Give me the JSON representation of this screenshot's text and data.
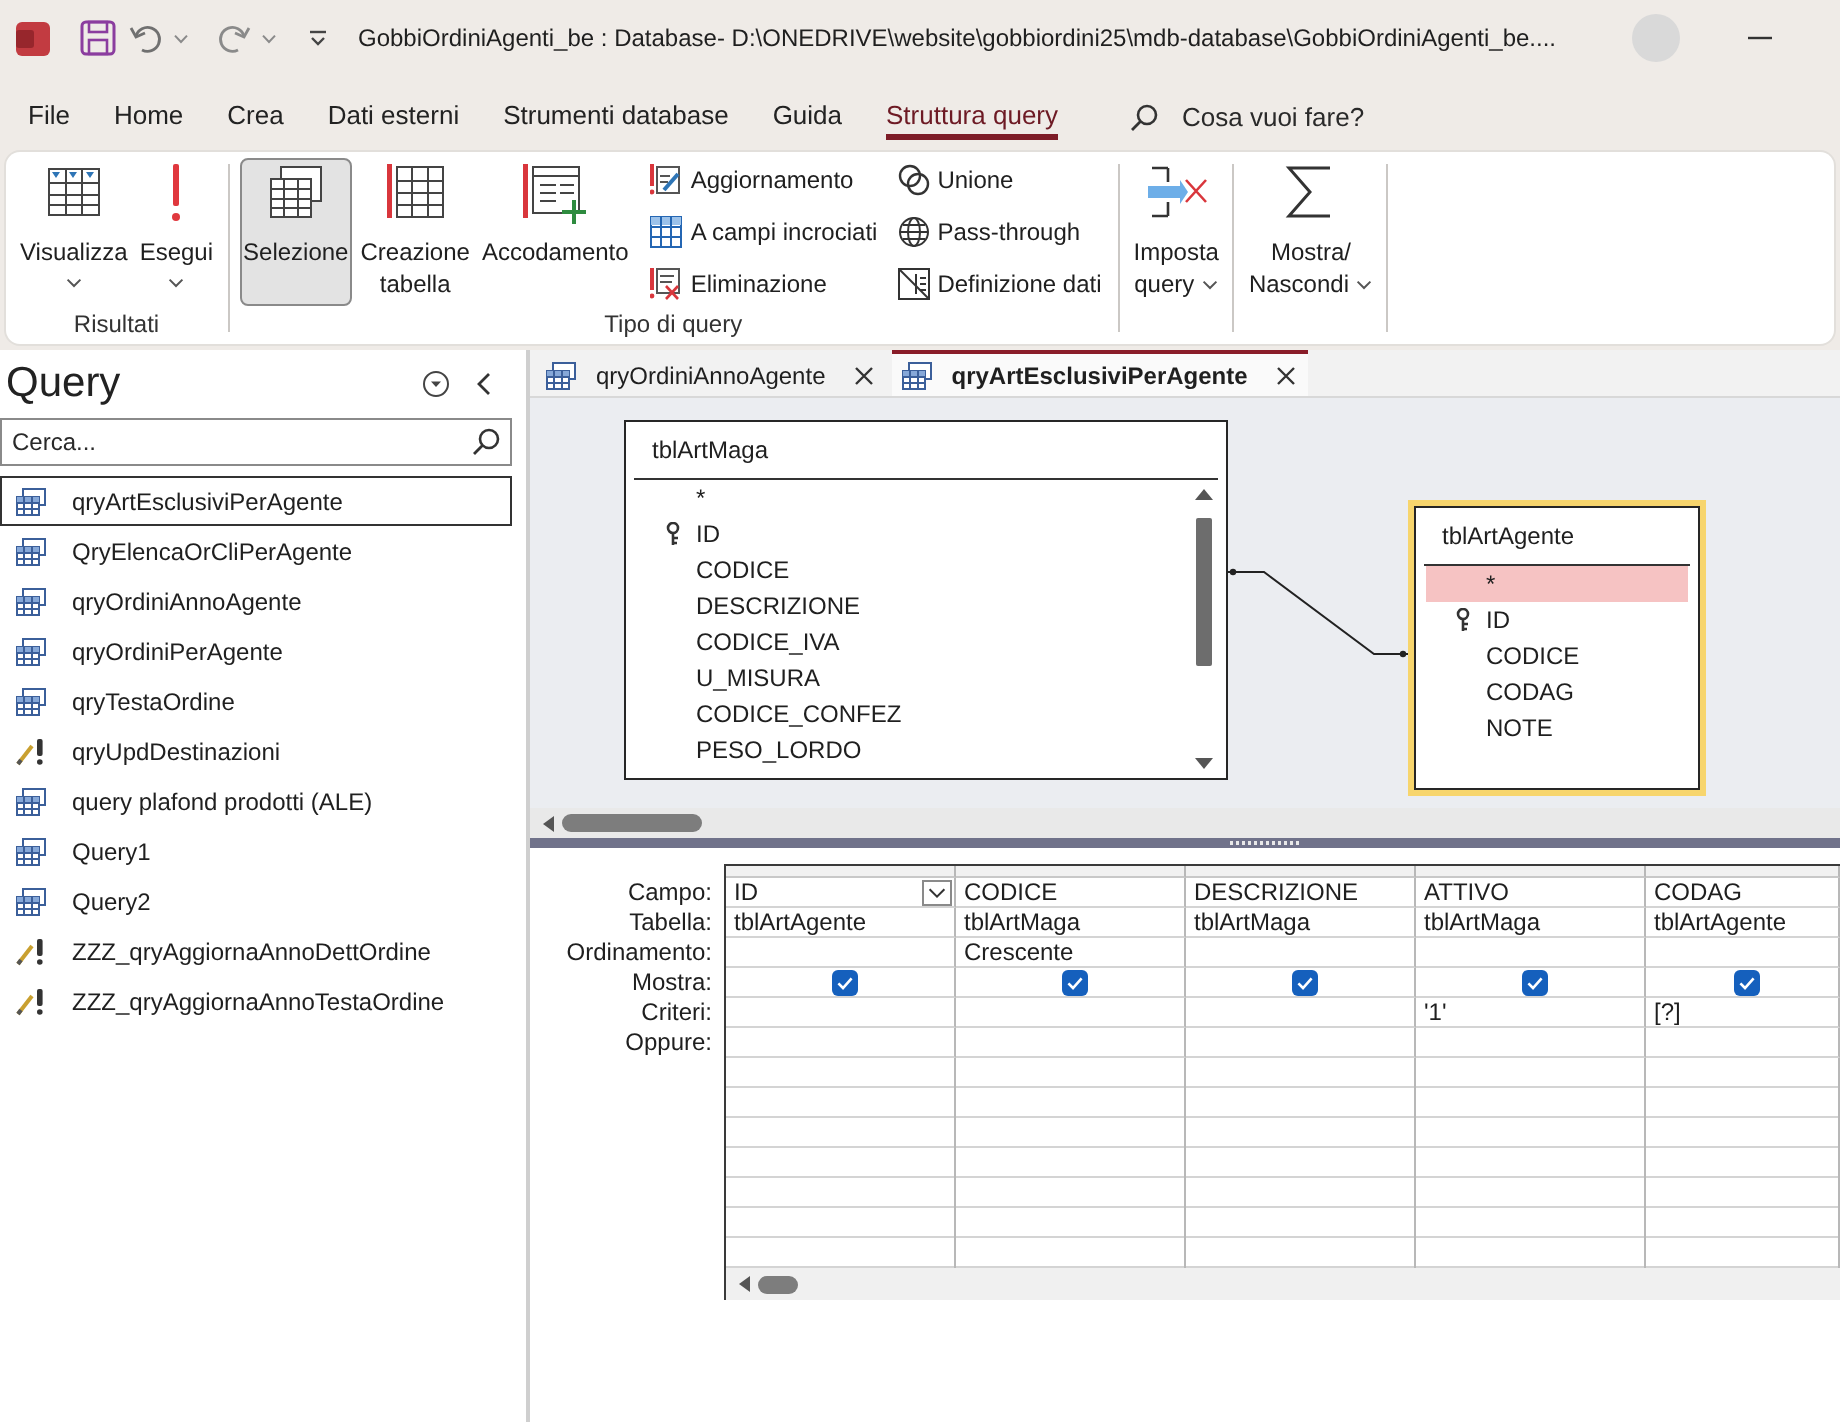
{
  "title_bar": {
    "title": "GobbiOrdiniAgenti_be : Database- D:\\ONEDRIVE\\website\\gobbiordini25\\mdb-database\\GobbiOrdiniAgenti_be...."
  },
  "menu_tabs": [
    {
      "label": "File",
      "selected": false
    },
    {
      "label": "Home",
      "selected": false
    },
    {
      "label": "Crea",
      "selected": false
    },
    {
      "label": "Dati esterni",
      "selected": false
    },
    {
      "label": "Strumenti database",
      "selected": false
    },
    {
      "label": "Guida",
      "selected": false
    },
    {
      "label": "Struttura query",
      "selected": true
    }
  ],
  "tell_me": {
    "placeholder": "Cosa vuoi fare?"
  },
  "ribbon": {
    "groups": [
      {
        "label": "Risultati",
        "large_buttons": [
          {
            "label": "Visualizza",
            "dropdown": true
          },
          {
            "label": "Esegui",
            "dropdown": true
          }
        ]
      },
      {
        "label": "Tipo di query",
        "large_buttons": [
          {
            "label": "Selezione",
            "dropdown": false,
            "selected": true
          },
          {
            "label": "Creazione\ntabella",
            "dropdown": false,
            "selected": false
          },
          {
            "label": "Accodamento",
            "dropdown": false,
            "selected": false
          }
        ],
        "small_buttons": [
          {
            "label": "Aggiornamento",
            "selected": false
          },
          {
            "label": "A campi incrociati",
            "selected": false
          },
          {
            "label": "Eliminazione",
            "selected": false
          },
          {
            "label": "Unione",
            "selected": false
          },
          {
            "label": "Pass-through",
            "selected": false
          },
          {
            "label": "Definizione dati",
            "selected": false
          }
        ]
      },
      {
        "large_buttons": [
          {
            "label": "Imposta\nquery",
            "dropdown": true
          }
        ]
      },
      {
        "large_buttons": [
          {
            "label": "Mostra/\nNascondi",
            "dropdown": true
          }
        ]
      }
    ]
  },
  "navigation_pane": {
    "title": "Query",
    "search": {
      "placeholder": "Cerca..."
    },
    "items": [
      {
        "label": "qryArtEsclusiviPerAgente",
        "kind": "select",
        "selected": true
      },
      {
        "label": "QryElencaOrCliPerAgente",
        "kind": "select",
        "selected": false
      },
      {
        "label": "qryOrdiniAnnoAgente",
        "kind": "select",
        "selected": false
      },
      {
        "label": "qryOrdiniPerAgente",
        "kind": "select",
        "selected": false
      },
      {
        "label": "qryTestaOrdine",
        "kind": "select",
        "selected": false
      },
      {
        "label": "qryUpdDestinazioni",
        "kind": "update",
        "selected": false
      },
      {
        "label": "query plafond prodotti (ALE)",
        "kind": "select",
        "selected": false
      },
      {
        "label": "Query1",
        "kind": "select",
        "selected": false
      },
      {
        "label": "Query2",
        "kind": "select",
        "selected": false
      },
      {
        "label": "ZZZ_qryAggiornaAnnoDettOrdine",
        "kind": "update",
        "selected": false
      },
      {
        "label": "ZZZ_qryAggiornaAnnoTestaOrdine",
        "kind": "update",
        "selected": false
      }
    ]
  },
  "document_tabs": [
    {
      "label": "qryOrdiniAnnoAgente",
      "selected": false
    },
    {
      "label": "qryArtEsclusiviPerAgente",
      "selected": true
    }
  ],
  "design_view": {
    "tables": [
      {
        "name": "tblArtMaga",
        "selected": false,
        "fields": [
          {
            "name": "*",
            "key": false,
            "selected": false
          },
          {
            "name": "ID",
            "key": true,
            "selected": false
          },
          {
            "name": "CODICE",
            "key": false,
            "selected": false
          },
          {
            "name": "DESCRIZIONE",
            "key": false,
            "selected": false
          },
          {
            "name": "CODICE_IVA",
            "key": false,
            "selected": false
          },
          {
            "name": "U_MISURA",
            "key": false,
            "selected": false
          },
          {
            "name": "CODICE_CONFEZ",
            "key": false,
            "selected": false
          },
          {
            "name": "PESO_LORDO",
            "key": false,
            "selected": false
          }
        ]
      },
      {
        "name": "tblArtAgente",
        "selected": true,
        "fields": [
          {
            "name": "*",
            "key": false,
            "selected": true
          },
          {
            "name": "ID",
            "key": true,
            "selected": false
          },
          {
            "name": "CODICE",
            "key": false,
            "selected": false
          },
          {
            "name": "CODAG",
            "key": false,
            "selected": false
          },
          {
            "name": "NOTE",
            "key": false,
            "selected": false
          }
        ]
      }
    ],
    "grid": {
      "row_labels": [
        "Campo:",
        "Tabella:",
        "Ordinamento:",
        "Mostra:",
        "Criteri:",
        "Oppure:"
      ],
      "columns": [
        {
          "field": "ID",
          "table": "tblArtAgente",
          "show": true,
          "selected": true
        },
        {
          "field": "CODICE",
          "table": "tblArtMaga",
          "sort": "Crescente",
          "show": true,
          "selected": false
        },
        {
          "field": "DESCRIZIONE",
          "table": "tblArtMaga",
          "show": true,
          "selected": false
        },
        {
          "field": "ATTIVO",
          "table": "tblArtMaga",
          "show": true,
          "criteria": "'1'",
          "selected": false
        },
        {
          "field": "CODAG",
          "table": "tblArtAgente",
          "show": true,
          "criteria": "[?]",
          "selected": false
        }
      ]
    }
  }
}
